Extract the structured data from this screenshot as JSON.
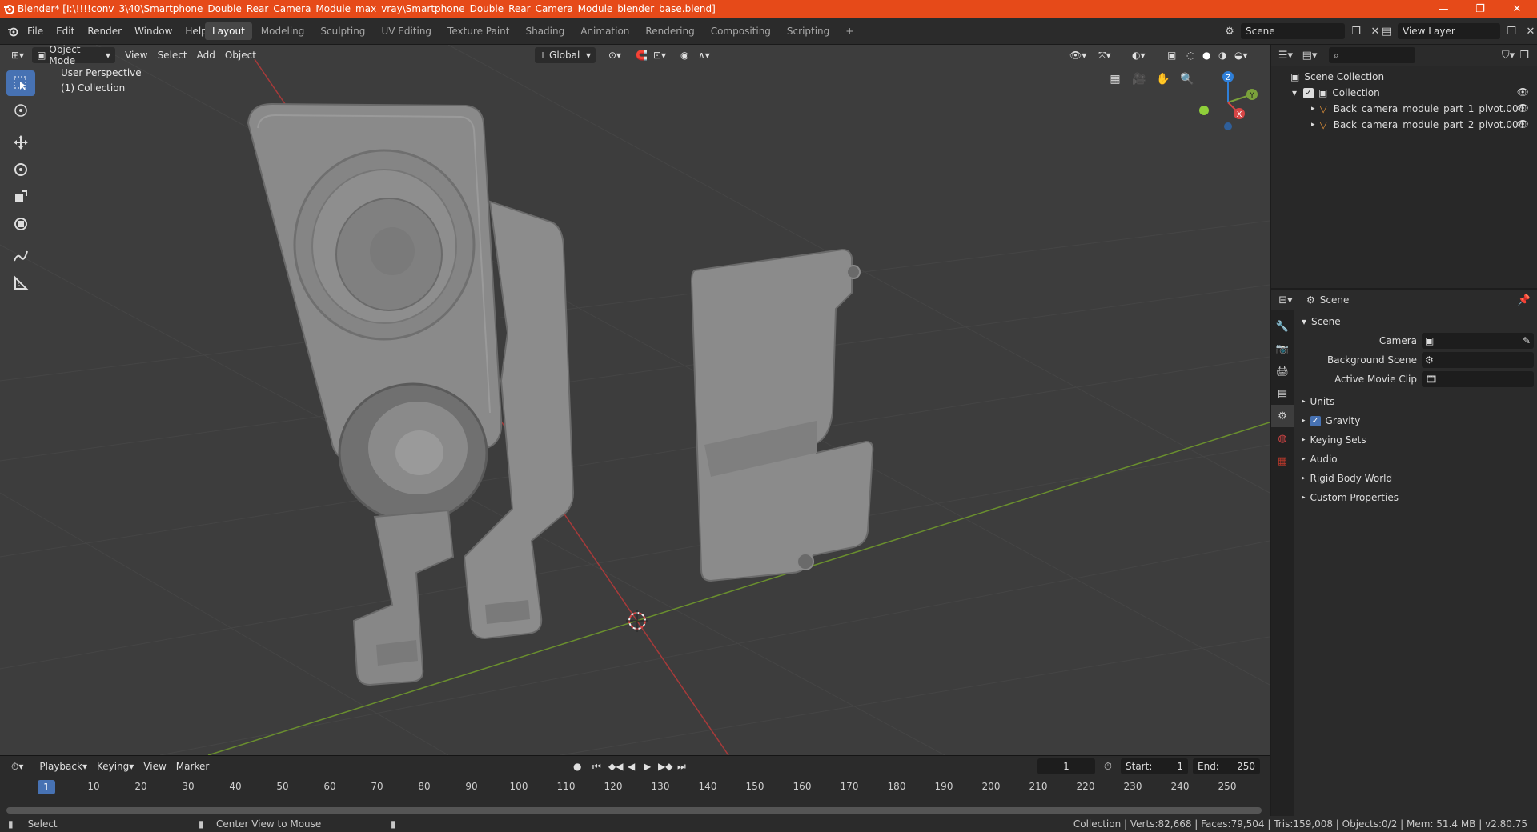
{
  "window": {
    "title": "Blender* [I:\\!!!!conv_3\\40\\Smartphone_Double_Rear_Camera_Module_max_vray\\Smartphone_Double_Rear_Camera_Module_blender_base.blend]",
    "minimize": "—",
    "restore": "❐",
    "close": "✕"
  },
  "menu": [
    "File",
    "Edit",
    "Render",
    "Window",
    "Help"
  ],
  "workspaces": [
    {
      "label": "Layout",
      "active": true
    },
    {
      "label": "Modeling"
    },
    {
      "label": "Sculpting"
    },
    {
      "label": "UV Editing"
    },
    {
      "label": "Texture Paint"
    },
    {
      "label": "Shading"
    },
    {
      "label": "Animation"
    },
    {
      "label": "Rendering"
    },
    {
      "label": "Compositing"
    },
    {
      "label": "Scripting"
    }
  ],
  "add_workspace": "+",
  "scene_selector": {
    "value": "Scene"
  },
  "viewlayer_selector": {
    "value": "View Layer"
  },
  "viewport": {
    "mode": "Object Mode",
    "menus": [
      "View",
      "Select",
      "Add",
      "Object"
    ],
    "orientation": "Global",
    "perspective_label": "User Perspective",
    "collection_label": "(1) Collection",
    "gizmo": {
      "x": "X",
      "y": "Y",
      "z": "Z"
    }
  },
  "timeline": {
    "menus": [
      "Playback",
      "Keying",
      "View",
      "Marker"
    ],
    "current_frame": "1",
    "start_label": "Start:",
    "start_value": "1",
    "end_label": "End:",
    "end_value": "250",
    "ticks": [
      "10",
      "20",
      "30",
      "40",
      "50",
      "60",
      "70",
      "80",
      "90",
      "100",
      "110",
      "120",
      "130",
      "140",
      "150",
      "160",
      "170",
      "180",
      "190",
      "200",
      "210",
      "220",
      "230",
      "240",
      "250"
    ],
    "marker": "1"
  },
  "statusbar": {
    "left_action": "Select",
    "middle_action": "Center View to Mouse",
    "stats": "Collection | Verts:82,668 | Faces:79,504 | Tris:159,008 | Objects:0/2 | Mem: 51.4 MB | v2.80.75"
  },
  "outliner": {
    "root": "Scene Collection",
    "collection": "Collection",
    "objects": [
      "Back_camera_module_part_1_pivot.004",
      "Back_camera_module_part_2_pivot.004"
    ]
  },
  "properties": {
    "header": "Scene",
    "panel_title": "Scene",
    "camera_label": "Camera",
    "background_label": "Background Scene",
    "movieclip_label": "Active Movie Clip",
    "sections": [
      "Units",
      "Gravity",
      "Keying Sets",
      "Audio",
      "Rigid Body World",
      "Custom Properties"
    ]
  },
  "colors": {
    "titlebar": "#e64a19",
    "accent": "#4772b3",
    "viewport_bg": "#3d3d3d",
    "x_axis": "#d64545",
    "y_axis": "#7aa13b",
    "z_axis": "#2f7fd8"
  }
}
